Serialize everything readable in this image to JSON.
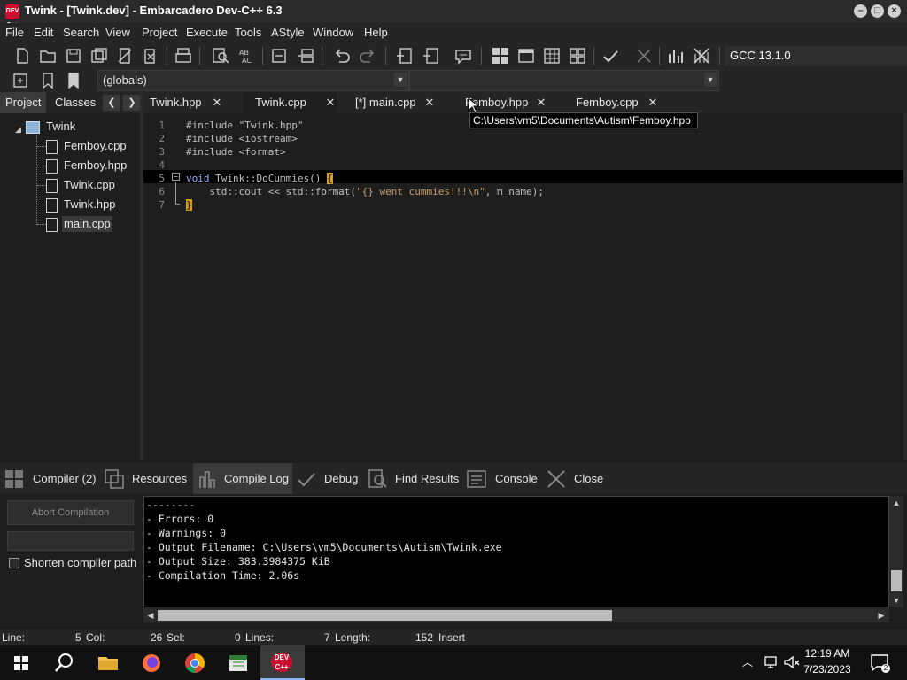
{
  "window": {
    "title": "Twink - [Twink.dev] - Embarcadero Dev-C++ 6.3",
    "app_icon_text": "DEV C++"
  },
  "menu": [
    "File",
    "Edit",
    "Search",
    "View",
    "Project",
    "Execute",
    "Tools",
    "AStyle",
    "Window",
    "Help"
  ],
  "toolbar": {
    "compiler_select": "GCC 13.1.0",
    "scope_combo": "(globals)"
  },
  "left_panel": {
    "tabs": [
      "Project",
      "Classes"
    ],
    "tree_root": "Twink",
    "files": [
      "Femboy.cpp",
      "Femboy.hpp",
      "Twink.cpp",
      "Twink.hpp",
      "main.cpp"
    ]
  },
  "editor": {
    "tabs": [
      {
        "label": "Twink.hpp",
        "active": false
      },
      {
        "label": "Twink.cpp",
        "active": true
      },
      {
        "label": "[*] main.cpp",
        "active": false
      },
      {
        "label": "Femboy.hpp",
        "active": false
      },
      {
        "label": "Femboy.cpp",
        "active": false
      }
    ],
    "tooltip": "C:\\Users\\vm5\\Documents\\Autism\\Femboy.hpp",
    "line_numbers": [
      "1",
      "2",
      "3",
      "4",
      "5",
      "6",
      "7"
    ],
    "lines": [
      {
        "l": "#include \"Twink.hpp\""
      },
      {
        "l": "#include <iostream>"
      },
      {
        "l": "#include <format>"
      },
      {
        "l": ""
      },
      {
        "kw": "void",
        "rest": " Twink::DoCummies() ",
        "brace": "{"
      },
      {
        "a": "    std::cout << std::format(",
        "s": "\"{} went cummies!!!\\n\"",
        "b": ", m_name);"
      },
      {
        "brace": "}"
      }
    ]
  },
  "bottom_tabs": [
    {
      "label": "Compiler (2)",
      "icon": "grid-icon"
    },
    {
      "label": "Resources",
      "icon": "resources-icon"
    },
    {
      "label": "Compile Log",
      "icon": "chart-icon",
      "active": true
    },
    {
      "label": "Debug",
      "icon": "check-icon"
    },
    {
      "label": "Find Results",
      "icon": "find-icon"
    },
    {
      "label": "Console",
      "icon": "console-icon"
    },
    {
      "label": "Close",
      "icon": "close-icon"
    }
  ],
  "compile_panel": {
    "abort_label": "Abort Compilation",
    "shorten_label": "Shorten compiler path",
    "log": [
      "--------",
      "- Errors: 0",
      "- Warnings: 0",
      "- Output Filename: C:\\Users\\vm5\\Documents\\Autism\\Twink.exe",
      "- Output Size: 383.3984375 KiB",
      "- Compilation Time: 2.06s"
    ]
  },
  "statusbar": {
    "line_label": "Line:",
    "line_val": "5",
    "col_label": "Col:",
    "col_val": "26",
    "sel_label": "Sel:",
    "sel_val": "0",
    "lines_label": "Lines:",
    "lines_val": "7",
    "length_label": "Length:",
    "length_val": "152",
    "mode": "Insert"
  },
  "taskbar": {
    "time": "12:19 AM",
    "date": "7/23/2023",
    "dev_icon_text": "DEV C++"
  },
  "colors": {
    "keyword": "#8fb4ff",
    "string": "#c8a06a",
    "brace_bg": "#d4a017",
    "accent_red": "#c8102e"
  }
}
